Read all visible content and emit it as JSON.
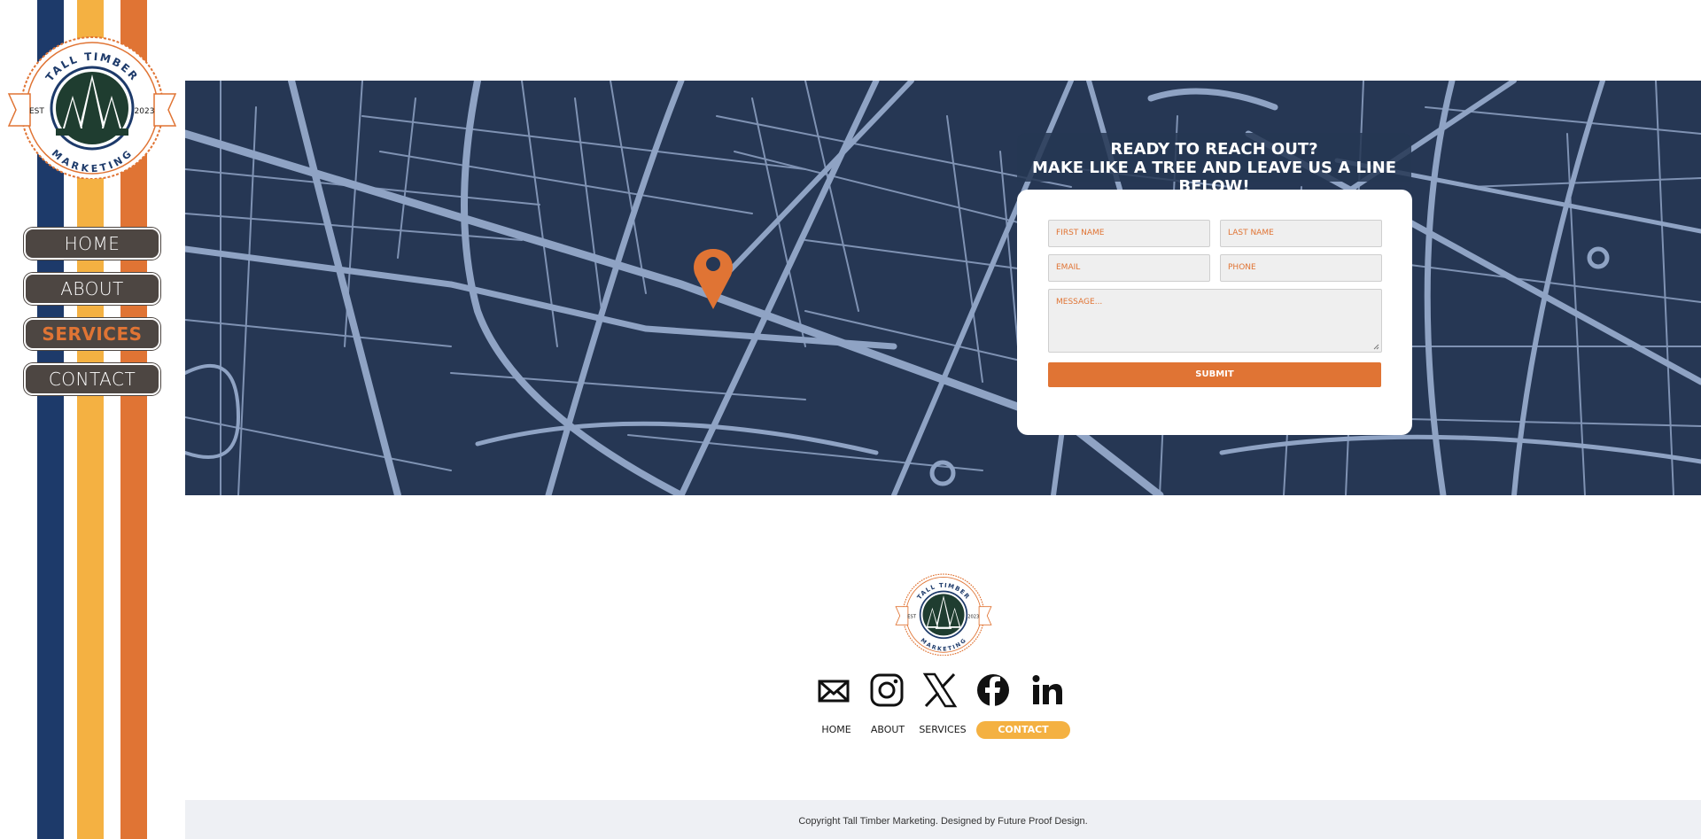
{
  "brand": {
    "name_top": "TALL TIMBER",
    "name_bottom": "MARKETING",
    "est_left": "EST",
    "est_right": "2023"
  },
  "nav": {
    "items": [
      {
        "label": "HOME",
        "active": false
      },
      {
        "label": "ABOUT",
        "active": false
      },
      {
        "label": "SERVICES",
        "active": true
      },
      {
        "label": "CONTACT",
        "active": false
      }
    ]
  },
  "contact": {
    "title_line1": "READY TO REACH OUT?",
    "title_line2": "MAKE LIKE A TREE AND LEAVE US A LINE BELOW!",
    "first_name_placeholder": "FIRST NAME",
    "last_name_placeholder": "LAST NAME",
    "email_placeholder": "EMAIL",
    "phone_placeholder": "PHONE",
    "message_placeholder": "MESSAGE...",
    "submit_label": "SUBMIT"
  },
  "footer": {
    "socials": [
      "email-icon",
      "instagram-icon",
      "x-icon",
      "facebook-icon",
      "linkedin-icon"
    ],
    "nav": [
      {
        "label": "HOME",
        "active": false
      },
      {
        "label": "ABOUT",
        "active": false
      },
      {
        "label": "SERVICES",
        "active": false
      },
      {
        "label": "CONTACT",
        "active": true
      }
    ],
    "copyright": "Copyright Tall Timber Marketing. Designed by Future Proof Design."
  },
  "colors": {
    "navy": "#1d3a6a",
    "yellow": "#f4b142",
    "orange": "#e07434",
    "map_bg": "#263754",
    "road": "#8fa3c4",
    "button_bg": "#4d4642",
    "forest": "#1f3d30"
  }
}
